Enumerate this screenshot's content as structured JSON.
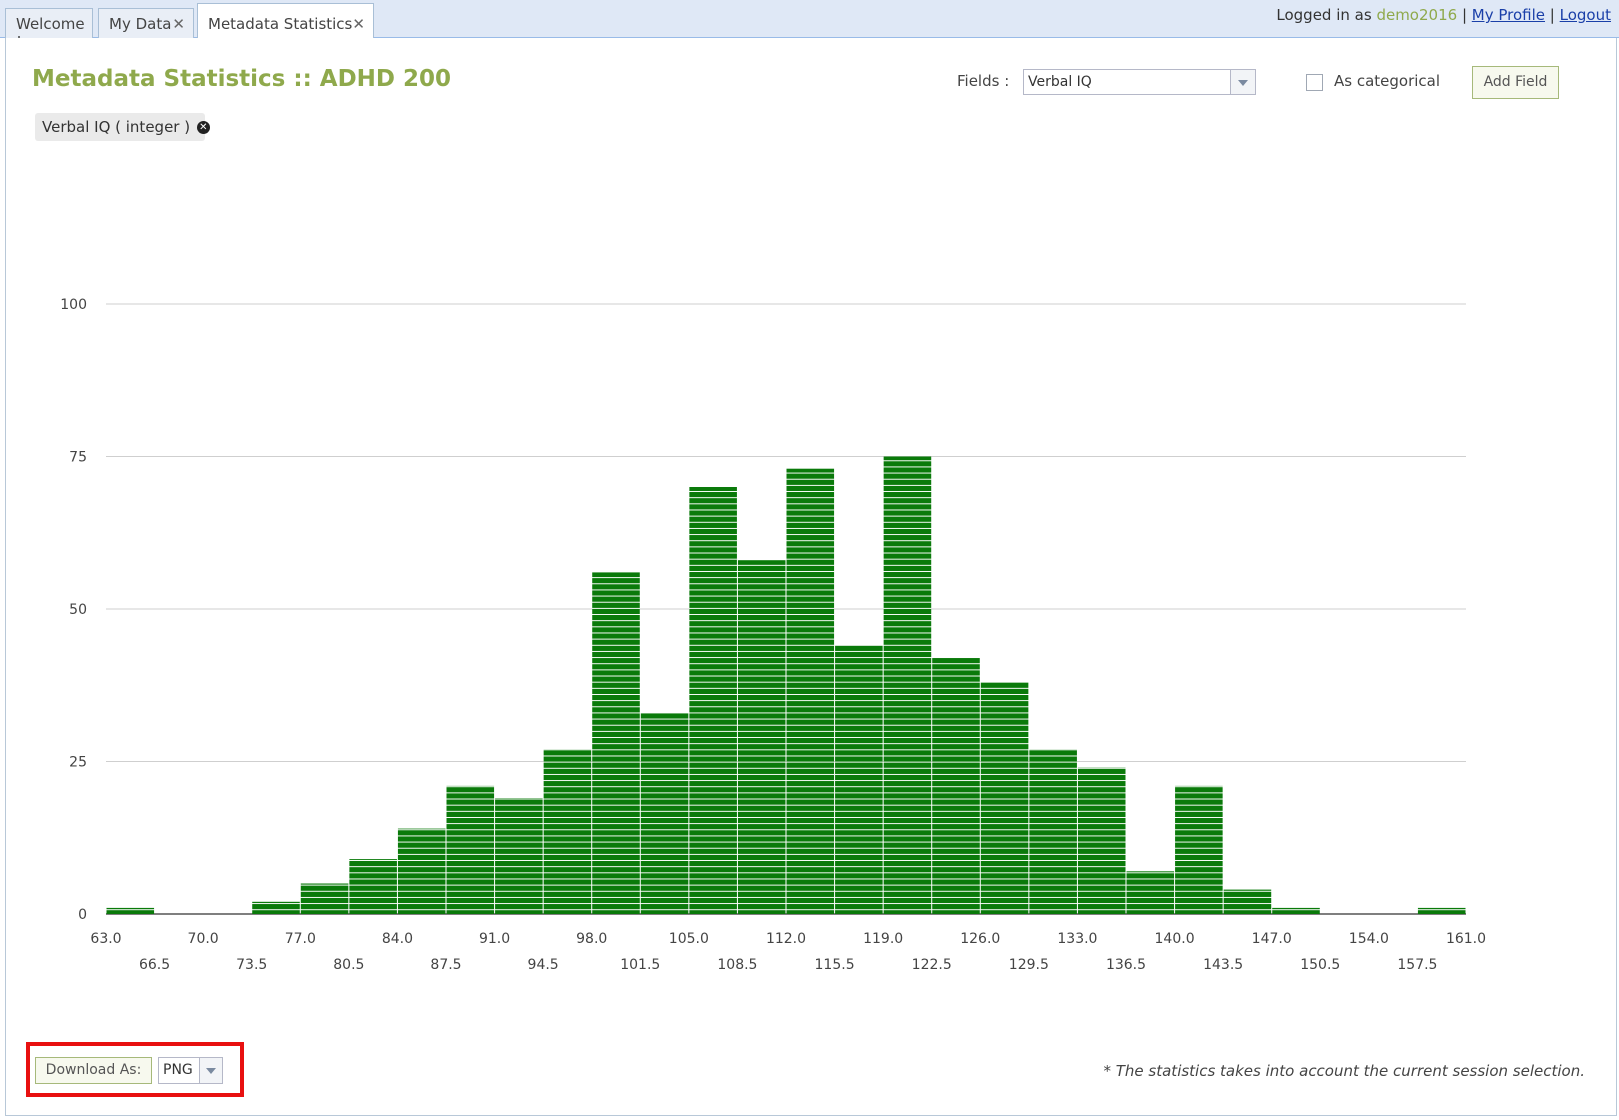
{
  "tabs": [
    {
      "label": "Welcome !",
      "closable": false,
      "active": false
    },
    {
      "label": "My Data",
      "closable": true,
      "active": false
    },
    {
      "label": "Metadata Statistics",
      "closable": true,
      "active": true
    }
  ],
  "header": {
    "logged_in_label": "Logged in as",
    "username": "demo2016",
    "separator": "|",
    "profile_link": "My Profile",
    "logout_link": "Logout"
  },
  "page": {
    "title": "Metadata Statistics :: ADHD 200",
    "fields_label": "Fields :",
    "fields_value": "Verbal IQ",
    "categorical_label": "As categorical",
    "categorical_checked": false,
    "add_field_label": "Add Field",
    "selected_field_tag": "Verbal IQ ( integer )"
  },
  "footer": {
    "download_label": "Download As:",
    "download_format": "PNG",
    "note": "* The statistics takes into account the current session selection."
  },
  "colors": {
    "accent": "#8fa94c",
    "bar": "#0a7a0a",
    "highlight": "#e81010"
  },
  "chart_data": {
    "type": "bar",
    "subtype": "histogram",
    "xlim": [
      63.0,
      161.0
    ],
    "bin_width": 3.5,
    "ylim": [
      0,
      100
    ],
    "y_ticks": [
      0,
      25,
      50,
      75,
      100
    ],
    "x_ticks_upper": [
      "63.0",
      "70.0",
      "77.0",
      "84.0",
      "91.0",
      "98.0",
      "105.0",
      "112.0",
      "119.0",
      "126.0",
      "133.0",
      "140.0",
      "147.0",
      "154.0",
      "161.0"
    ],
    "x_ticks_lower": [
      "66.5",
      "73.5",
      "80.5",
      "87.5",
      "94.5",
      "101.5",
      "108.5",
      "115.5",
      "122.5",
      "129.5",
      "136.5",
      "143.5",
      "150.5",
      "157.5"
    ],
    "bins_start": [
      63.0,
      66.5,
      70.0,
      73.5,
      77.0,
      80.5,
      84.0,
      87.5,
      91.0,
      94.5,
      98.0,
      101.5,
      105.0,
      108.5,
      112.0,
      115.5,
      119.0,
      122.5,
      126.0,
      129.5,
      133.0,
      136.5,
      140.0,
      143.5,
      147.0,
      150.5,
      154.0,
      157.5
    ],
    "values": [
      1,
      0,
      0,
      2,
      5,
      9,
      14,
      21,
      19,
      27,
      56,
      33,
      70,
      58,
      73,
      44,
      75,
      42,
      38,
      27,
      24,
      7,
      21,
      4,
      1,
      0,
      0,
      1
    ],
    "grid": true
  }
}
